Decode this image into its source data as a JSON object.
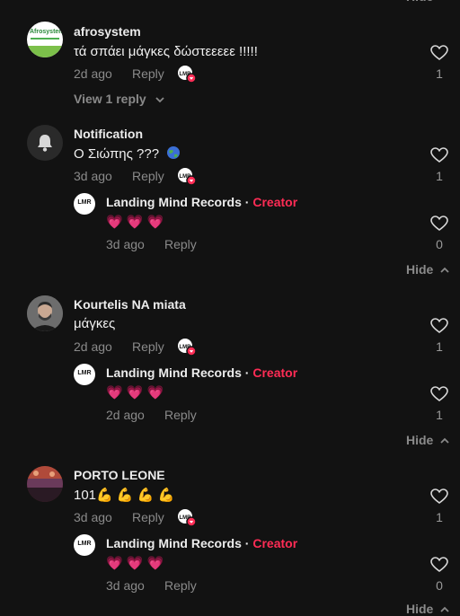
{
  "comments": [
    {
      "author": "afrosystem",
      "text": "τά σπάει μάγκες δώστεεεεε !!!!!",
      "time": "2d ago",
      "reply_label": "Reply",
      "likes": "1",
      "view_replies": "View 1 reply",
      "avatar_logo_text": "Afrosystem"
    },
    {
      "author": "Notification",
      "text": "Ο Σιώπης ???",
      "time": "3d ago",
      "reply_label": "Reply",
      "likes": "1",
      "reply": {
        "author": "Landing Mind Records",
        "separator": "·",
        "badge": "Creator",
        "text": "💗 💗 💗",
        "time": "3d ago",
        "reply_label": "Reply",
        "likes": "0"
      },
      "hide_label": "Hide"
    },
    {
      "author": "Kourtelis NA miata",
      "text": "μάγκες",
      "time": "2d ago",
      "reply_label": "Reply",
      "likes": "1",
      "reply": {
        "author": "Landing Mind Records",
        "separator": "·",
        "badge": "Creator",
        "text": "💗 💗 💗",
        "time": "2d ago",
        "reply_label": "Reply",
        "likes": "1"
      },
      "hide_label": "Hide"
    },
    {
      "author": "PORTO LEONE",
      "text": "101💪 💪 💪 💪",
      "time": "3d ago",
      "reply_label": "Reply",
      "likes": "1",
      "reply": {
        "author": "Landing Mind Records",
        "separator": "·",
        "badge": "Creator",
        "text": "💗 💗 💗",
        "time": "3d ago",
        "reply_label": "Reply",
        "likes": "0"
      },
      "hide_label": "Hide"
    }
  ],
  "creator_avatar_text": "LMR",
  "colors": {
    "background": "#121212",
    "creator": "#fe2c55",
    "muted": "#8a8a8a"
  },
  "icons": [
    "heart-outline-icon",
    "liked-by-creator-icon",
    "bell-icon",
    "chevron-down-icon",
    "chevron-up-icon",
    "globe-icon"
  ]
}
